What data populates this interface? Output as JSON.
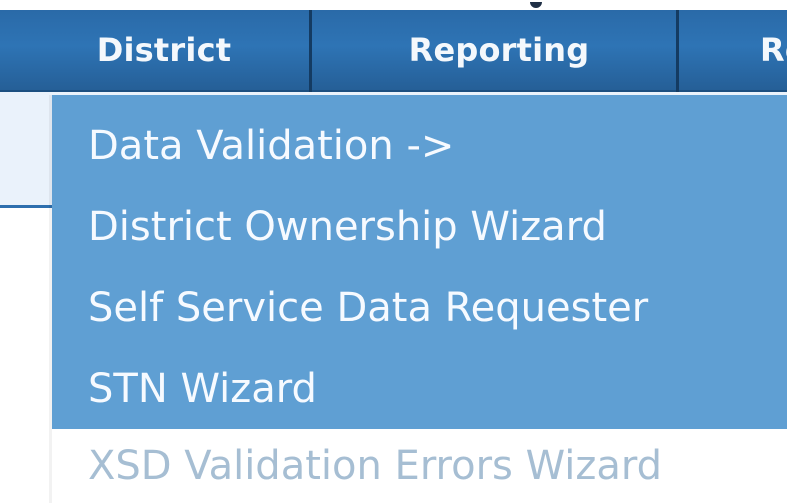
{
  "nav": {
    "items": [
      {
        "label": "District"
      },
      {
        "label": "Reporting"
      },
      {
        "label": "Re"
      }
    ]
  },
  "dropdown": {
    "items": [
      {
        "label": "Data Validation ->"
      },
      {
        "label": "District Ownership Wizard"
      },
      {
        "label": "Self Service Data Requester"
      },
      {
        "label": "STN Wizard"
      },
      {
        "label": "XSD Validation Errors Wizard"
      }
    ]
  },
  "colors": {
    "nav_bg": "#2e74b5",
    "dropdown_bg": "#5f9fd3",
    "menu_text": "#f6faff",
    "hovered_bg": "#ffffff",
    "hovered_text": "#a6bed3"
  }
}
